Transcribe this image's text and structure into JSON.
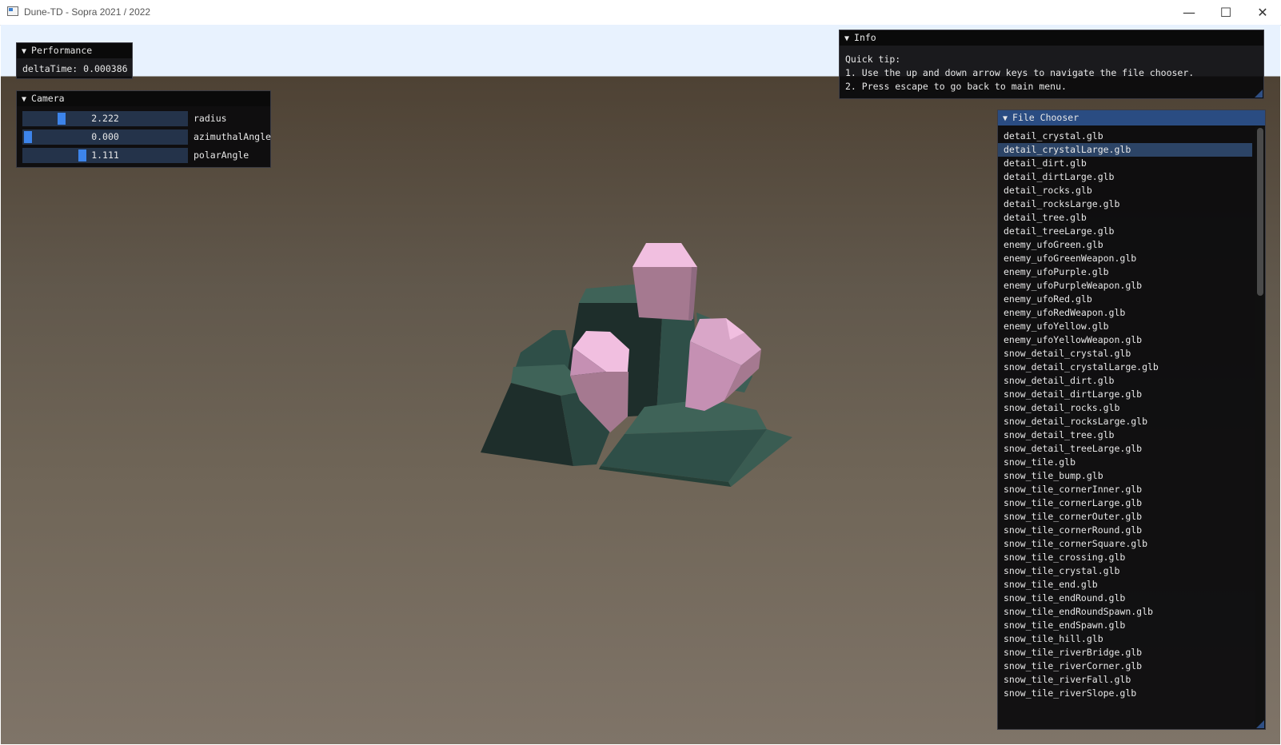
{
  "window": {
    "title": "Dune-TD - Sopra 2021 / 2022",
    "minimize_glyph": "—",
    "maximize_glyph": "☐",
    "close_glyph": "✕"
  },
  "performance": {
    "title": "Performance",
    "delta_label": "deltaTime: 0.000386"
  },
  "camera": {
    "title": "Camera",
    "sliders": [
      {
        "value": "2.222",
        "label": "radius",
        "fill_fraction": 0.22
      },
      {
        "value": "0.000",
        "label": "azimuthalAngle",
        "fill_fraction": 0.0
      },
      {
        "value": "1.111",
        "label": "polarAngle",
        "fill_fraction": 0.35
      }
    ]
  },
  "info": {
    "title": "Info",
    "lines": [
      "Quick tip:",
      "1. Use the up and down arrow keys to navigate the file chooser.",
      "2. Press escape to go back to main menu."
    ]
  },
  "file_chooser": {
    "title": "File Chooser",
    "selected_index": 1,
    "files": [
      "detail_crystal.glb",
      "detail_crystalLarge.glb",
      "detail_dirt.glb",
      "detail_dirtLarge.glb",
      "detail_rocks.glb",
      "detail_rocksLarge.glb",
      "detail_tree.glb",
      "detail_treeLarge.glb",
      "enemy_ufoGreen.glb",
      "enemy_ufoGreenWeapon.glb",
      "enemy_ufoPurple.glb",
      "enemy_ufoPurpleWeapon.glb",
      "enemy_ufoRed.glb",
      "enemy_ufoRedWeapon.glb",
      "enemy_ufoYellow.glb",
      "enemy_ufoYellowWeapon.glb",
      "snow_detail_crystal.glb",
      "snow_detail_crystalLarge.glb",
      "snow_detail_dirt.glb",
      "snow_detail_dirtLarge.glb",
      "snow_detail_rocks.glb",
      "snow_detail_rocksLarge.glb",
      "snow_detail_tree.glb",
      "snow_detail_treeLarge.glb",
      "snow_tile.glb",
      "snow_tile_bump.glb",
      "snow_tile_cornerInner.glb",
      "snow_tile_cornerLarge.glb",
      "snow_tile_cornerOuter.glb",
      "snow_tile_cornerRound.glb",
      "snow_tile_cornerSquare.glb",
      "snow_tile_crossing.glb",
      "snow_tile_crystal.glb",
      "snow_tile_end.glb",
      "snow_tile_endRound.glb",
      "snow_tile_endRoundSpawn.glb",
      "snow_tile_endSpawn.glb",
      "snow_tile_hill.glb",
      "snow_tile_riverBridge.glb",
      "snow_tile_riverCorner.glb",
      "snow_tile_riverFall.glb",
      "snow_tile_riverSlope.glb"
    ],
    "scroll_position": 0.0
  },
  "colors": {
    "panel_bg": "#0a0a0c",
    "active_header": "#2a4c82",
    "slider_track": "#24334a",
    "slider_grab": "#3d84ea",
    "selected_row": "#2c4466",
    "rock_dark": "#1e2e2b",
    "rock_mid": "#2f4f48",
    "rock_light": "#3f6358",
    "crystal_light": "#f1bfe0",
    "crystal_mid": "#c590b3",
    "crystal_dark": "#a57990"
  }
}
